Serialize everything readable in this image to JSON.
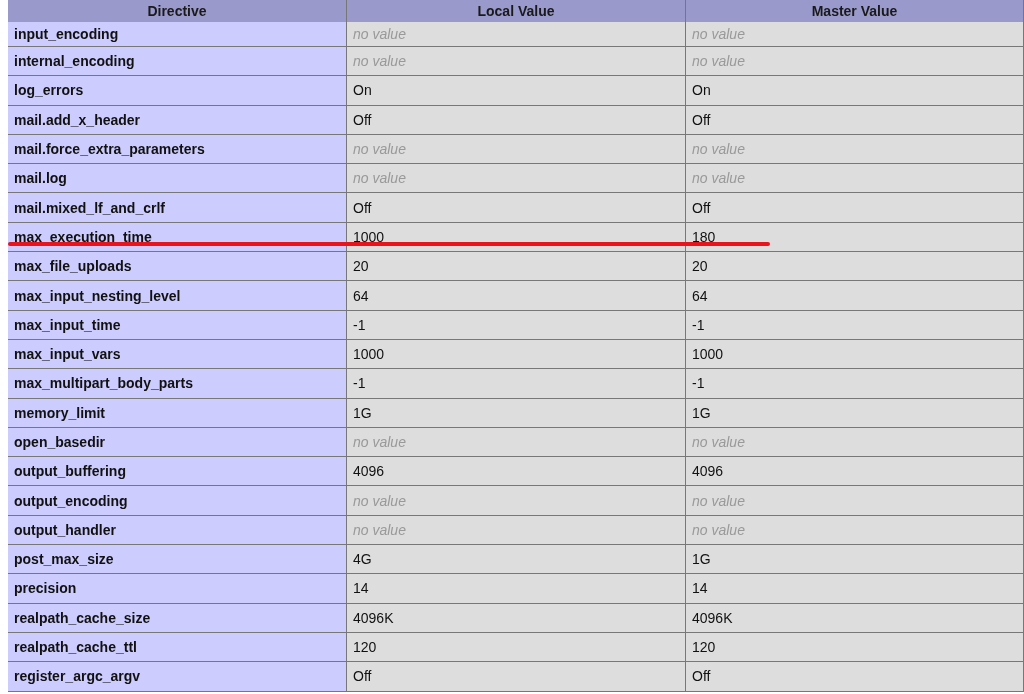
{
  "table": {
    "columns": [
      "Directive",
      "Local Value",
      "Master Value"
    ],
    "rows": [
      {
        "directive": "input_encoding",
        "local": "no value",
        "master": "no value",
        "empty": true,
        "highlighted": false
      },
      {
        "directive": "internal_encoding",
        "local": "no value",
        "master": "no value",
        "empty": true,
        "highlighted": false
      },
      {
        "directive": "log_errors",
        "local": "On",
        "master": "On",
        "empty": false,
        "highlighted": false
      },
      {
        "directive": "mail.add_x_header",
        "local": "Off",
        "master": "Off",
        "empty": false,
        "highlighted": false
      },
      {
        "directive": "mail.force_extra_parameters",
        "local": "no value",
        "master": "no value",
        "empty": true,
        "highlighted": false
      },
      {
        "directive": "mail.log",
        "local": "no value",
        "master": "no value",
        "empty": true,
        "highlighted": false
      },
      {
        "directive": "mail.mixed_lf_and_crlf",
        "local": "Off",
        "master": "Off",
        "empty": false,
        "highlighted": false
      },
      {
        "directive": "max_execution_time",
        "local": "1000",
        "master": "180",
        "empty": false,
        "highlighted": true
      },
      {
        "directive": "max_file_uploads",
        "local": "20",
        "master": "20",
        "empty": false,
        "highlighted": false
      },
      {
        "directive": "max_input_nesting_level",
        "local": "64",
        "master": "64",
        "empty": false,
        "highlighted": false
      },
      {
        "directive": "max_input_time",
        "local": "-1",
        "master": "-1",
        "empty": false,
        "highlighted": false
      },
      {
        "directive": "max_input_vars",
        "local": "1000",
        "master": "1000",
        "empty": false,
        "highlighted": false
      },
      {
        "directive": "max_multipart_body_parts",
        "local": "-1",
        "master": "-1",
        "empty": false,
        "highlighted": false
      },
      {
        "directive": "memory_limit",
        "local": "1G",
        "master": "1G",
        "empty": false,
        "highlighted": false
      },
      {
        "directive": "open_basedir",
        "local": "no value",
        "master": "no value",
        "empty": true,
        "highlighted": false
      },
      {
        "directive": "output_buffering",
        "local": "4096",
        "master": "4096",
        "empty": false,
        "highlighted": false
      },
      {
        "directive": "output_encoding",
        "local": "no value",
        "master": "no value",
        "empty": true,
        "highlighted": false
      },
      {
        "directive": "output_handler",
        "local": "no value",
        "master": "no value",
        "empty": true,
        "highlighted": false
      },
      {
        "directive": "post_max_size",
        "local": "4G",
        "master": "1G",
        "empty": false,
        "highlighted": false
      },
      {
        "directive": "precision",
        "local": "14",
        "master": "14",
        "empty": false,
        "highlighted": false
      },
      {
        "directive": "realpath_cache_size",
        "local": "4096K",
        "master": "4096K",
        "empty": false,
        "highlighted": false
      },
      {
        "directive": "realpath_cache_ttl",
        "local": "120",
        "master": "120",
        "empty": false,
        "highlighted": false
      },
      {
        "directive": "register_argc_argv",
        "local": "Off",
        "master": "Off",
        "empty": false,
        "highlighted": false
      }
    ]
  }
}
